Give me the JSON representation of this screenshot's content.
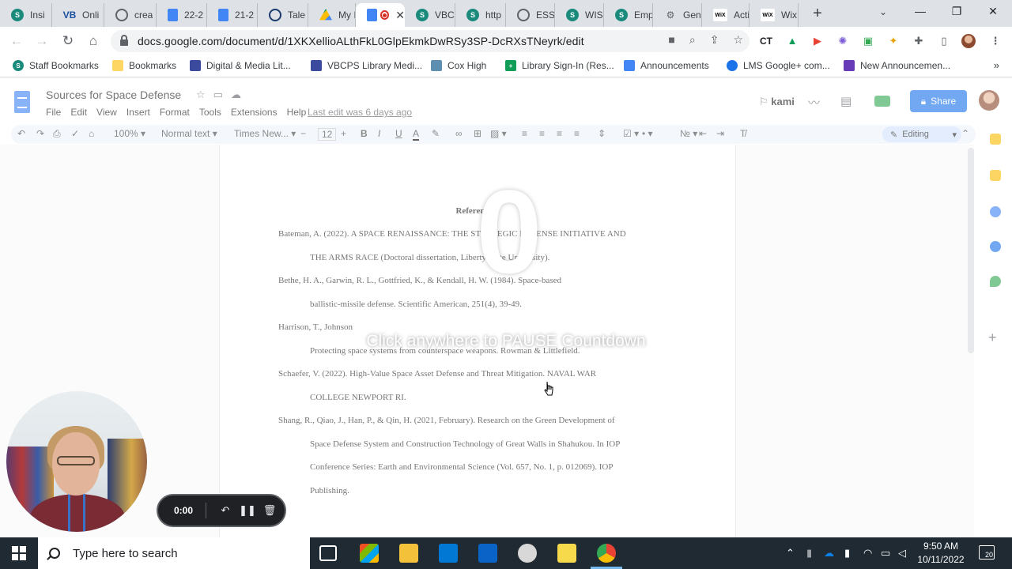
{
  "browser": {
    "tabs": [
      {
        "icon": "s-icon",
        "title": "Insi",
        "active": false
      },
      {
        "icon": "vb-icon",
        "title": "Onli",
        "active": false
      },
      {
        "icon": "globe-icon",
        "title": "crea",
        "active": false
      },
      {
        "icon": "doc-icon",
        "title": "22-2",
        "active": false
      },
      {
        "icon": "doc-icon",
        "title": "21-2",
        "active": false
      },
      {
        "icon": "clock-icon",
        "title": "Tale",
        "active": false
      },
      {
        "icon": "drive-icon",
        "title": "My I",
        "active": false
      },
      {
        "icon": "doc-icon",
        "title": "",
        "active": true
      },
      {
        "icon": "s-icon",
        "title": "VBC",
        "active": false
      },
      {
        "icon": "s-icon",
        "title": "http",
        "active": false
      },
      {
        "icon": "globe-icon",
        "title": "ESS",
        "active": false
      },
      {
        "icon": "s-icon",
        "title": "WIS",
        "active": false
      },
      {
        "icon": "s-icon",
        "title": "Emp",
        "active": false
      },
      {
        "icon": "gen-icon",
        "title": "Gen",
        "active": false
      },
      {
        "icon": "wix-icon",
        "title": "Acti",
        "active": false
      },
      {
        "icon": "wix-icon",
        "title": "Wix",
        "active": false
      }
    ],
    "url": "docs.google.com/document/d/1XKXellioALthFkL0GlpEkmkDwRSy3SP-DcRXsTNeyrk/edit",
    "extension_ct": "CT",
    "bookmarks": [
      {
        "label": "Staff Bookmarks",
        "color": "#1a8a7d"
      },
      {
        "label": "Bookmarks",
        "color": "#fdd663"
      },
      {
        "label": "Digital & Media Lit...",
        "color": "#3c4a9e"
      },
      {
        "label": "VBCPS Library Medi...",
        "color": "#3c4a9e"
      },
      {
        "label": "Cox High",
        "color": "#5f8fb0"
      },
      {
        "label": "Library Sign-In (Res...",
        "color": "#0f9d58"
      },
      {
        "label": "Announcements",
        "color": "#4285f4"
      },
      {
        "label": "LMS Google+ com...",
        "color": "#1a73e8"
      },
      {
        "label": "New Announcemen...",
        "color": "#673ab7"
      }
    ]
  },
  "docs": {
    "title": "Sources for Space Defense",
    "menu": [
      "File",
      "Edit",
      "View",
      "Insert",
      "Format",
      "Tools",
      "Extensions",
      "Help"
    ],
    "last_edit": "Last edit was 6 days ago",
    "kami_label": "kami",
    "share_label": "Share",
    "toolbar": {
      "zoom": "100%",
      "style": "Normal text",
      "font": "Times New...",
      "size": "12",
      "mode": "Editing"
    },
    "references": {
      "heading": "References",
      "lines": [
        {
          "text": "Bateman, A. (2022). A SPACE RENAISSANCE: THE STRATEGIC DEFENSE INITIATIVE AND",
          "indent": false
        },
        {
          "text": "THE ARMS RACE (Doctoral dissertation, Liberty State University).",
          "indent": true
        },
        {
          "text": "Bethe, H. A., Garwin, R. L., Gottfried, K., & Kendall, H. W. (1984). Space-based",
          "indent": false
        },
        {
          "text": "ballistic-missile defense. Scientific American, 251(4), 39-49.",
          "indent": true
        },
        {
          "text": "Harrison, T., Johnson",
          "indent": false
        },
        {
          "text": "Protecting space systems from counterspace weapons. Rowman & Littlefield.",
          "indent": true
        },
        {
          "text": "Schaefer, V. (2022). High-Value Space Asset Defense and Threat Mitigation. NAVAL WAR",
          "indent": false
        },
        {
          "text": "COLLEGE NEWPORT RI.",
          "indent": true
        },
        {
          "text": "Shang, R., Qiao, J., Han, P., & Qin, H. (2021, February). Research on the Green Development of",
          "indent": false
        },
        {
          "text": "Space Defense System and Construction Technology of Great Walls in Shahukou. In IOP",
          "indent": true
        },
        {
          "text": "Conference Series: Earth and Environmental Science (Vol. 657, No. 1, p. 012069). IOP",
          "indent": true
        },
        {
          "text": "Publishing.",
          "indent": true
        }
      ]
    }
  },
  "overlay": {
    "countdown": "0",
    "message": "Click anywhere to PAUSE Countdown"
  },
  "recorder": {
    "time": "0:00"
  },
  "taskbar": {
    "search_placeholder": "Type here to search",
    "time": "9:50 AM",
    "date": "10/11/2022",
    "notifications": "20"
  }
}
